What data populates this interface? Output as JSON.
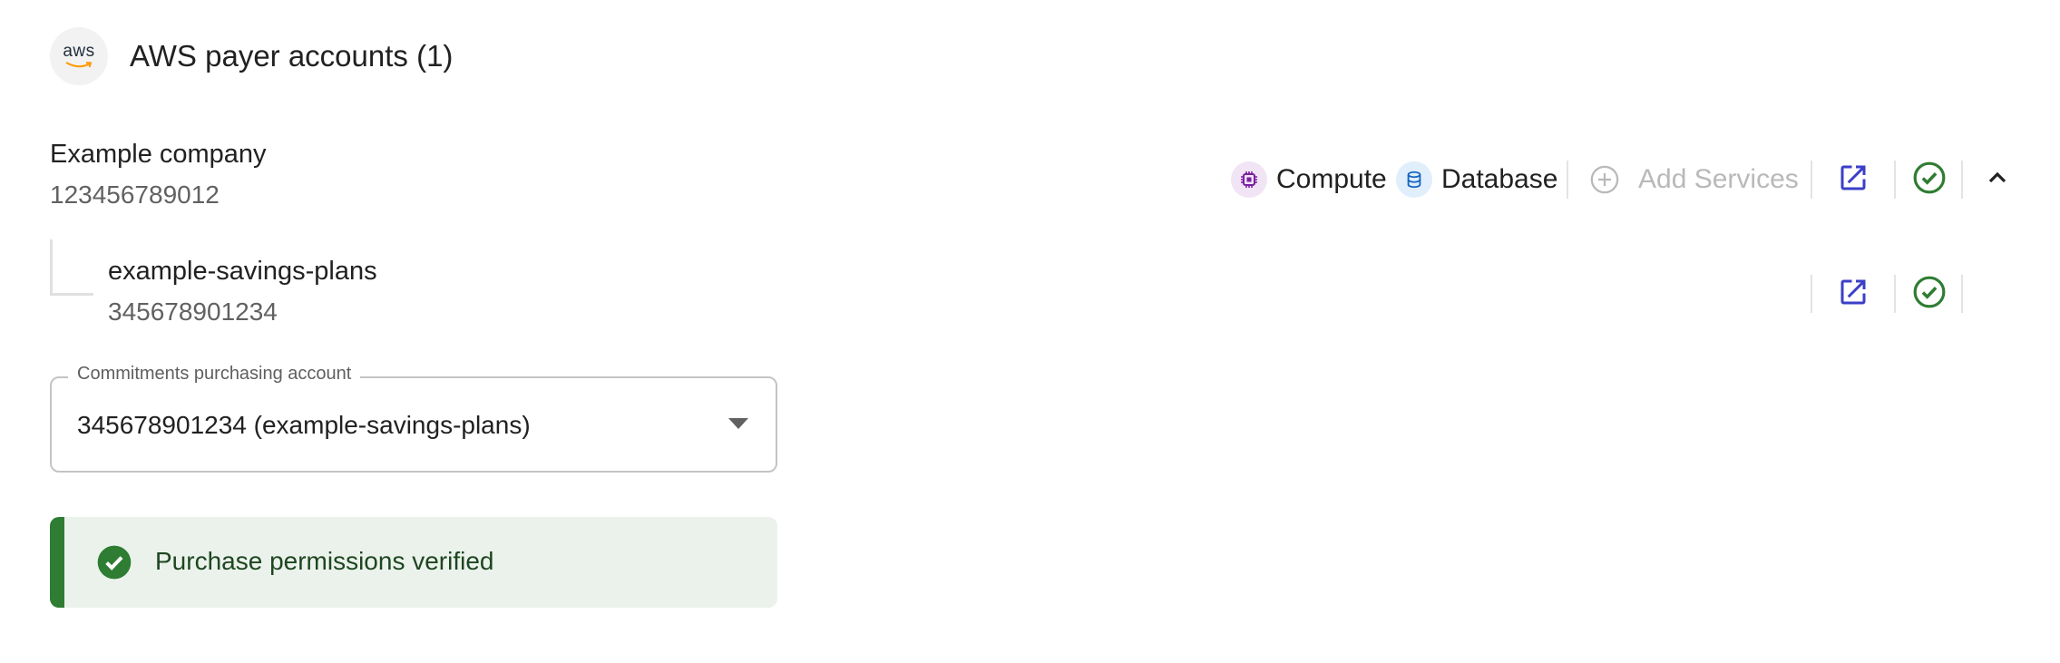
{
  "header": {
    "logo_text": "aws",
    "title": "AWS payer accounts (1)"
  },
  "payer_account": {
    "name": "Example company",
    "id": "123456789012",
    "services": [
      {
        "label": "Compute",
        "icon": "chip-icon",
        "color": "#7b1fa2",
        "bg": "#f1e4f5"
      },
      {
        "label": "Database",
        "icon": "database-icon",
        "color": "#1565c0",
        "bg": "#e1eefb"
      }
    ],
    "add_services_label": "Add Services"
  },
  "child_account": {
    "name": "example-savings-plans",
    "id": "345678901234"
  },
  "purchasing_select": {
    "label": "Commitments purchasing account",
    "value": "345678901234 (example-savings-plans)"
  },
  "alert": {
    "message": "Purchase permissions verified",
    "color": "#2e7d32"
  },
  "colors": {
    "link_icon": "#3b3fc7",
    "verified_icon": "#2e7d32"
  }
}
